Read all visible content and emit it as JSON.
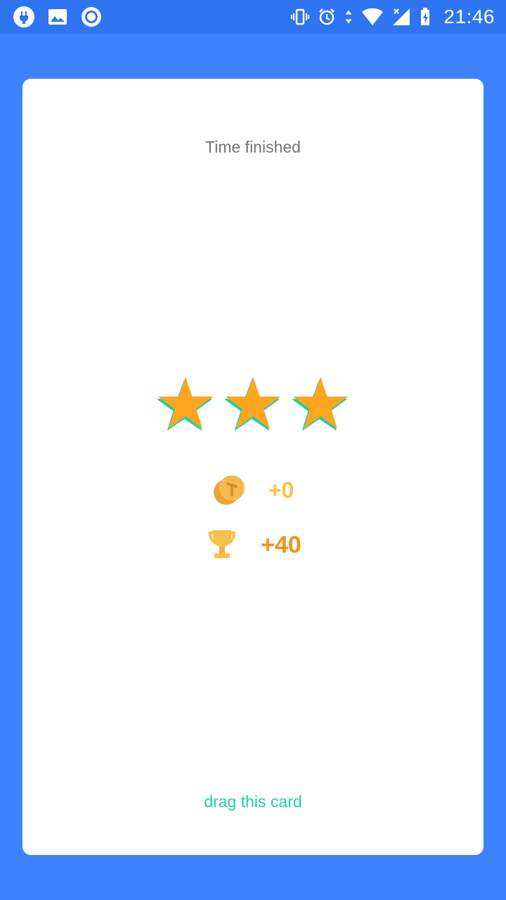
{
  "status_bar": {
    "time": "21:46",
    "left_icons": [
      "usb-debug-icon",
      "image-icon",
      "record-icon"
    ],
    "right_icons": [
      "vibrate-icon",
      "alarm-icon",
      "data-transfer-icon",
      "wifi-icon",
      "cell-signal-icon",
      "battery-charging-icon"
    ]
  },
  "card": {
    "title": "Time finished",
    "stars_earned": 3,
    "stars_total": 3,
    "coins": {
      "icon": "coin-icon",
      "value": "+0"
    },
    "trophy": {
      "icon": "trophy-icon",
      "value": "+40"
    },
    "drag_hint": "drag this card"
  },
  "colors": {
    "background": "#3d83ff",
    "status_bar": "#2f74f0",
    "card": "#ffffff",
    "star": "#ffa51f",
    "star_shadow": "#1dd1a1",
    "coin_text": "#ffc14a",
    "trophy_text": "#f5901c",
    "drag_hint": "#1dd1a1",
    "title_text": "#737373"
  }
}
